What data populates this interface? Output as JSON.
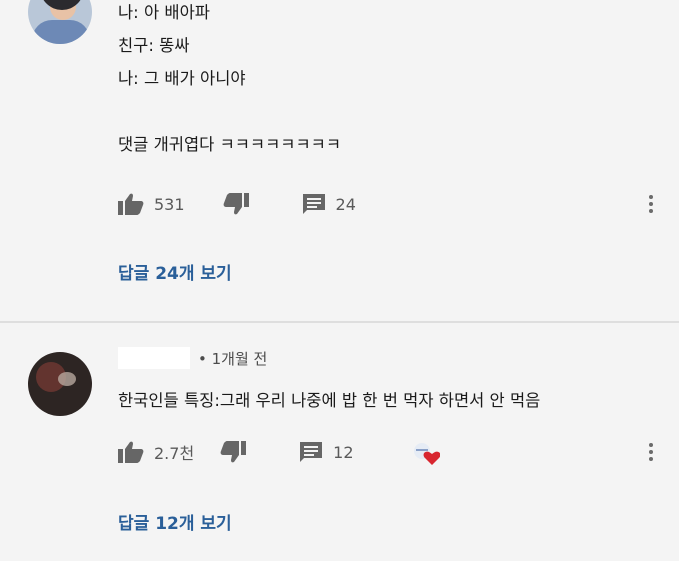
{
  "comment1": {
    "lines": [
      "나: 아 배아파",
      "친구: 똥싸",
      "나: 그 배가 아니야",
      "",
      "댓글 개귀엽다 ㅋㅋㅋㅋㅋㅋㅋㅋ"
    ],
    "likes": "531",
    "replies": "24",
    "view_replies": "답글 24개 보기"
  },
  "comment2": {
    "time": "• 1개월 전",
    "text": "한국인들 특징:그래 우리 나중에 밥 한 번 먹자 하면서 안 먹음",
    "likes": "2.7천",
    "replies": "12",
    "view_replies": "답글 12개 보기"
  },
  "colors": {
    "link": "#2a5f99",
    "background": "#f4f4f4",
    "heart": "#d8262f"
  }
}
